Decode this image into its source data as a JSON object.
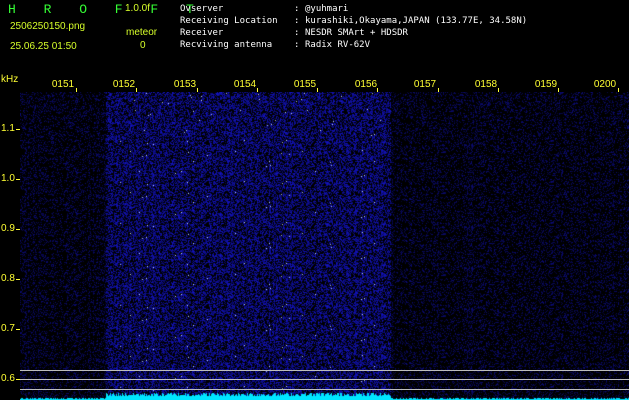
{
  "app": {
    "brand": "H R O F F T",
    "version": "1.0.0f"
  },
  "status": {
    "filename": "2506250150.png",
    "datetime": "25.06.25 01:50",
    "mode_label": "meteor",
    "count": "0"
  },
  "observation": [
    {
      "key": "Ovserver",
      "value": "@yuhmari"
    },
    {
      "key": "Receiving Location",
      "value": "kurashiki,Okayama,JAPAN (133.77E, 34.58N)"
    },
    {
      "key": "Receiver",
      "value": "NESDR SMArt + HDSDR"
    },
    {
      "key": "Recviving antenna",
      "value": "Radix RV-62V"
    }
  ],
  "time_axis": {
    "labels": [
      "0151",
      "0152",
      "0153",
      "0154",
      "0155",
      "0156",
      "0157",
      "0158",
      "0159",
      "0200"
    ]
  },
  "freq_axis": {
    "unit": "kHz",
    "labels": [
      "1.1",
      "1.0",
      "0.9",
      "0.8",
      "0.7",
      "0.6"
    ]
  },
  "waterfall": {
    "background": "#000000",
    "noise_color": "#2828c8",
    "spectrum_color": "#00e5ff",
    "active_region": {
      "start": "0151 + 50s",
      "end": "0156 + 50s"
    }
  }
}
